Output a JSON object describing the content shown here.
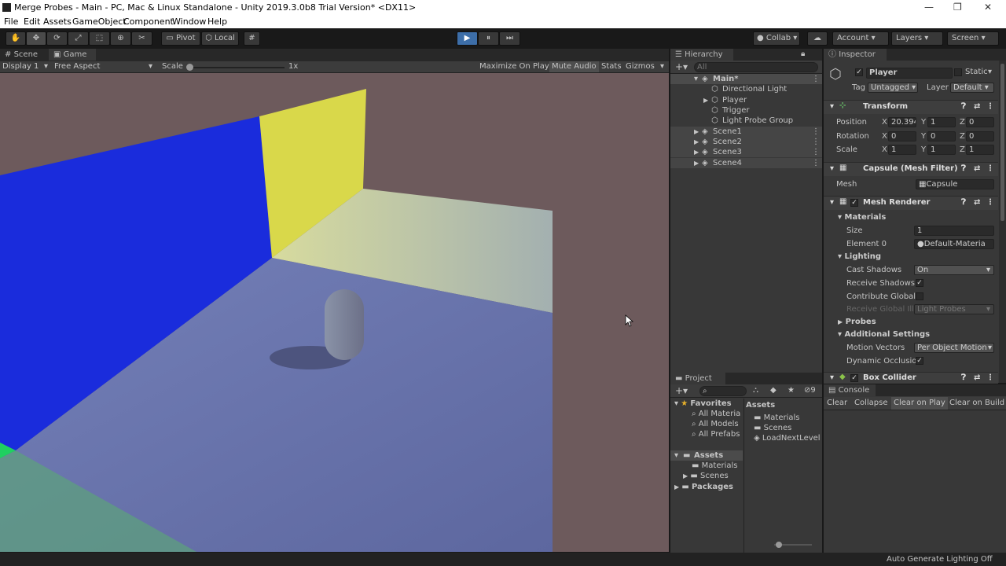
{
  "window": {
    "title": "Merge Probes - Main - PC, Mac & Linux Standalone - Unity 2019.3.0b8 Trial Version* <DX11>",
    "minimize": "—",
    "maximize": "❐",
    "close": "✕"
  },
  "menu": [
    "File",
    "Edit",
    "Assets",
    "GameObject",
    "Component",
    "Window",
    "Help"
  ],
  "toolbar": {
    "pivot": "Pivot",
    "local": "Local",
    "collab": "Collab",
    "account": "Account",
    "layers": "Layers",
    "layout": "Screen",
    "play": "▶",
    "pause": "⏸",
    "step": "⏭"
  },
  "scene_tabs": {
    "scene": "Scene",
    "game": "Game"
  },
  "game_bar": {
    "display": "Display 1",
    "aspect": "Free Aspect",
    "scale_label": "Scale",
    "scale_value": "1x",
    "maximize": "Maximize On Play",
    "mute": "Mute Audio",
    "stats": "Stats",
    "gizmos": "Gizmos"
  },
  "hierarchy": {
    "tab": "Hierarchy",
    "search_placeholder": "All",
    "items": [
      {
        "label": "Main*"
      },
      {
        "label": "Directional Light"
      },
      {
        "label": "Player"
      },
      {
        "label": "Trigger"
      },
      {
        "label": "Light Probe Group"
      },
      {
        "label": "Scene1"
      },
      {
        "label": "Scene2"
      },
      {
        "label": "Scene3"
      },
      {
        "label": "Scene4"
      }
    ]
  },
  "project": {
    "tab": "Project",
    "console_tab": "Console",
    "filter_count": "9",
    "favorites": "Favorites",
    "fav_items": [
      "All Materia",
      "All Models",
      "All Prefabs"
    ],
    "assets": "Assets",
    "asset_folders": [
      "Materials",
      "Scenes"
    ],
    "packages": "Packages",
    "assets_header": "Assets",
    "asset_items": [
      "Materials",
      "Scenes",
      "LoadNextLevel"
    ]
  },
  "console": {
    "clear": "Clear",
    "collapse": "Collapse",
    "clear_on_play": "Clear on Play",
    "clear_on_build": "Clear on Build"
  },
  "inspector": {
    "tab": "Inspector",
    "name": "Player",
    "static": "Static",
    "tag_label": "Tag",
    "tag": "Untagged",
    "layer_label": "Layer",
    "layer": "Default",
    "transform": {
      "title": "Transform",
      "position_label": "Position",
      "rotation_label": "Rotation",
      "scale_label": "Scale",
      "axis_x": "X",
      "axis_y": "Y",
      "axis_z": "Z",
      "position": [
        "20.394",
        "1",
        "0"
      ],
      "rotation": [
        "0",
        "0",
        "0"
      ],
      "scale": [
        "1",
        "1",
        "1"
      ]
    },
    "mesh_filter": {
      "title": "Capsule (Mesh Filter)",
      "mesh_label": "Mesh",
      "mesh": "Capsule"
    },
    "mesh_renderer": {
      "title": "Mesh Renderer",
      "materials": "Materials",
      "size_label": "Size",
      "size": "1",
      "element_label": "Element 0",
      "element": "Default-Materia",
      "lighting": "Lighting",
      "cast_label": "Cast Shadows",
      "cast": "On",
      "receive_label": "Receive Shadows",
      "contribute_label": "Contribute Global",
      "receive_gi_label": "Receive Global Illu",
      "receive_gi": "Light Probes",
      "probes": "Probes",
      "additional": "Additional Settings",
      "motion_label": "Motion Vectors",
      "motion": "Per Object Motion",
      "dynamic_label": "Dynamic Occlusio"
    },
    "box_collider": {
      "title": "Box Collider"
    }
  },
  "status": {
    "text": "Auto Generate Lighting Off"
  },
  "colors": {
    "blue_wall": "#1a2cdc",
    "yellow_wall": "#d9d84a",
    "floor": "#6d72a6",
    "accent": "#3d6ea8"
  }
}
